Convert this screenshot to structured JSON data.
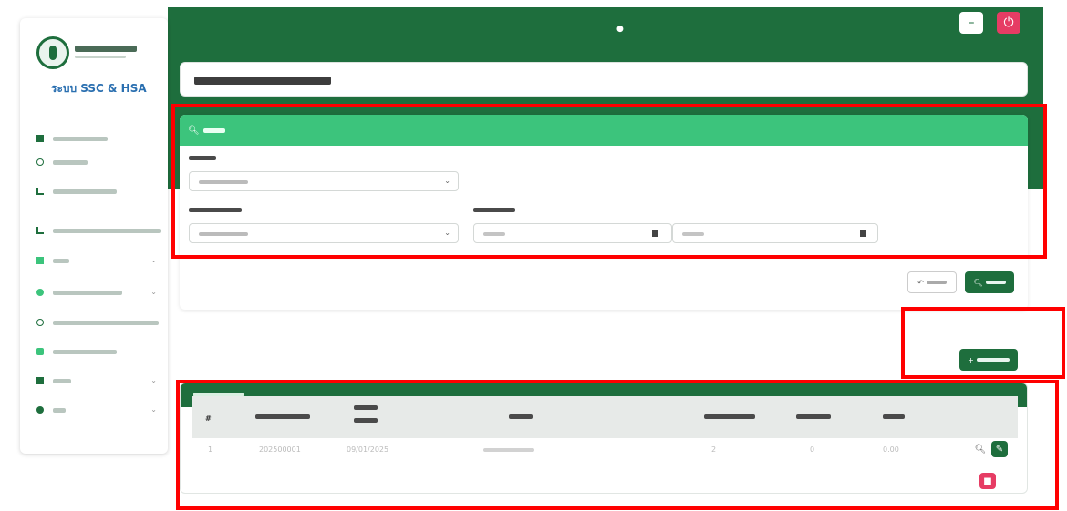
{
  "header": {
    "user_text": "",
    "minimize_label": "–",
    "power_label": "⏻"
  },
  "sidebar": {
    "brand": "ระบบ SSC & HSA",
    "items": [
      {
        "icon": "square-icon"
      },
      {
        "icon": "gauge-icon"
      },
      {
        "icon": "chart-icon"
      },
      {
        "icon": "chart-icon"
      },
      {
        "icon": "folder-icon",
        "expandable": true
      },
      {
        "icon": "wrench-icon",
        "expandable": true
      },
      {
        "icon": "globe-icon"
      },
      {
        "icon": "user-icon"
      },
      {
        "icon": "square-icon",
        "expandable": true
      },
      {
        "icon": "gear-icon",
        "expandable": true
      }
    ]
  },
  "page": {
    "title": ""
  },
  "search": {
    "header": "",
    "unit_label": "",
    "unit_value": "",
    "place_label": "",
    "place_value": "",
    "date_label": "",
    "date_from_placeholder": "",
    "date_to_placeholder": "",
    "reset_label": "",
    "search_label": ""
  },
  "actions": {
    "add_label": ""
  },
  "list": {
    "header": "",
    "columns": [
      "#",
      "",
      "",
      "",
      "",
      "",
      ""
    ],
    "rows": [
      {
        "no": "1",
        "code": "202500001",
        "date": "09/01/2025",
        "place": "",
        "count1": "2",
        "count2": "0",
        "value": "0.00"
      }
    ]
  },
  "colors": {
    "brand_green": "#1e6e3d",
    "search_green": "#3cc47c",
    "danger": "#e63c64",
    "highlight": "#ff0000"
  }
}
